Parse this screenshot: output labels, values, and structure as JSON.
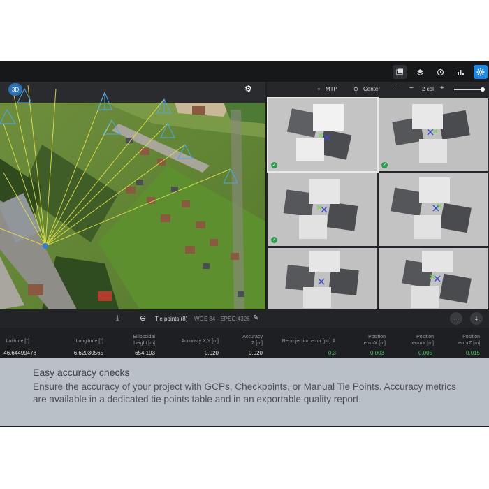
{
  "viewer": {
    "mode_3d": "3D"
  },
  "topbar": {
    "icons": [
      "gallery-icon",
      "layers-icon",
      "history-icon",
      "chart-icon",
      "settings-icon"
    ]
  },
  "right_panel": {
    "mtp_label": "MTP",
    "center_label": "Center",
    "col_label": "2 col",
    "minus": "−",
    "plus": "+",
    "more": "···"
  },
  "table_bar": {
    "title": "Tie points (8)",
    "crs": "WGS 84 - EPSG:4326"
  },
  "table": {
    "headers": [
      {
        "l1": "Latitude [°]",
        "l2": ""
      },
      {
        "l1": "Longitude [°]",
        "l2": ""
      },
      {
        "l1": "Ellipsoidal",
        "l2": "height [m]"
      },
      {
        "l1": "Accuracy X,Y [m]",
        "l2": ""
      },
      {
        "l1": "Accuracy",
        "l2": "Z [m]"
      },
      {
        "l1": "Reprojection error [px]",
        "l2": ""
      },
      {
        "l1": "Position",
        "l2": "errorX [m]"
      },
      {
        "l1": "Position",
        "l2": "errorY [m]"
      },
      {
        "l1": "Position",
        "l2": "errorZ [m]"
      }
    ],
    "row1": [
      "46.64499478",
      "6.62030565",
      "654.193",
      "0.020",
      "0.020",
      "0.3",
      "0.003",
      "0.005",
      "0.015"
    ]
  },
  "overlay": {
    "title": "Easy accuracy checks",
    "body": "Ensure the accuracy of your project with GCPs, Checkpoints, or Manual Tie Points. Accuracy metrics are available in a dedicated tie points table and in an exportable quality report."
  }
}
